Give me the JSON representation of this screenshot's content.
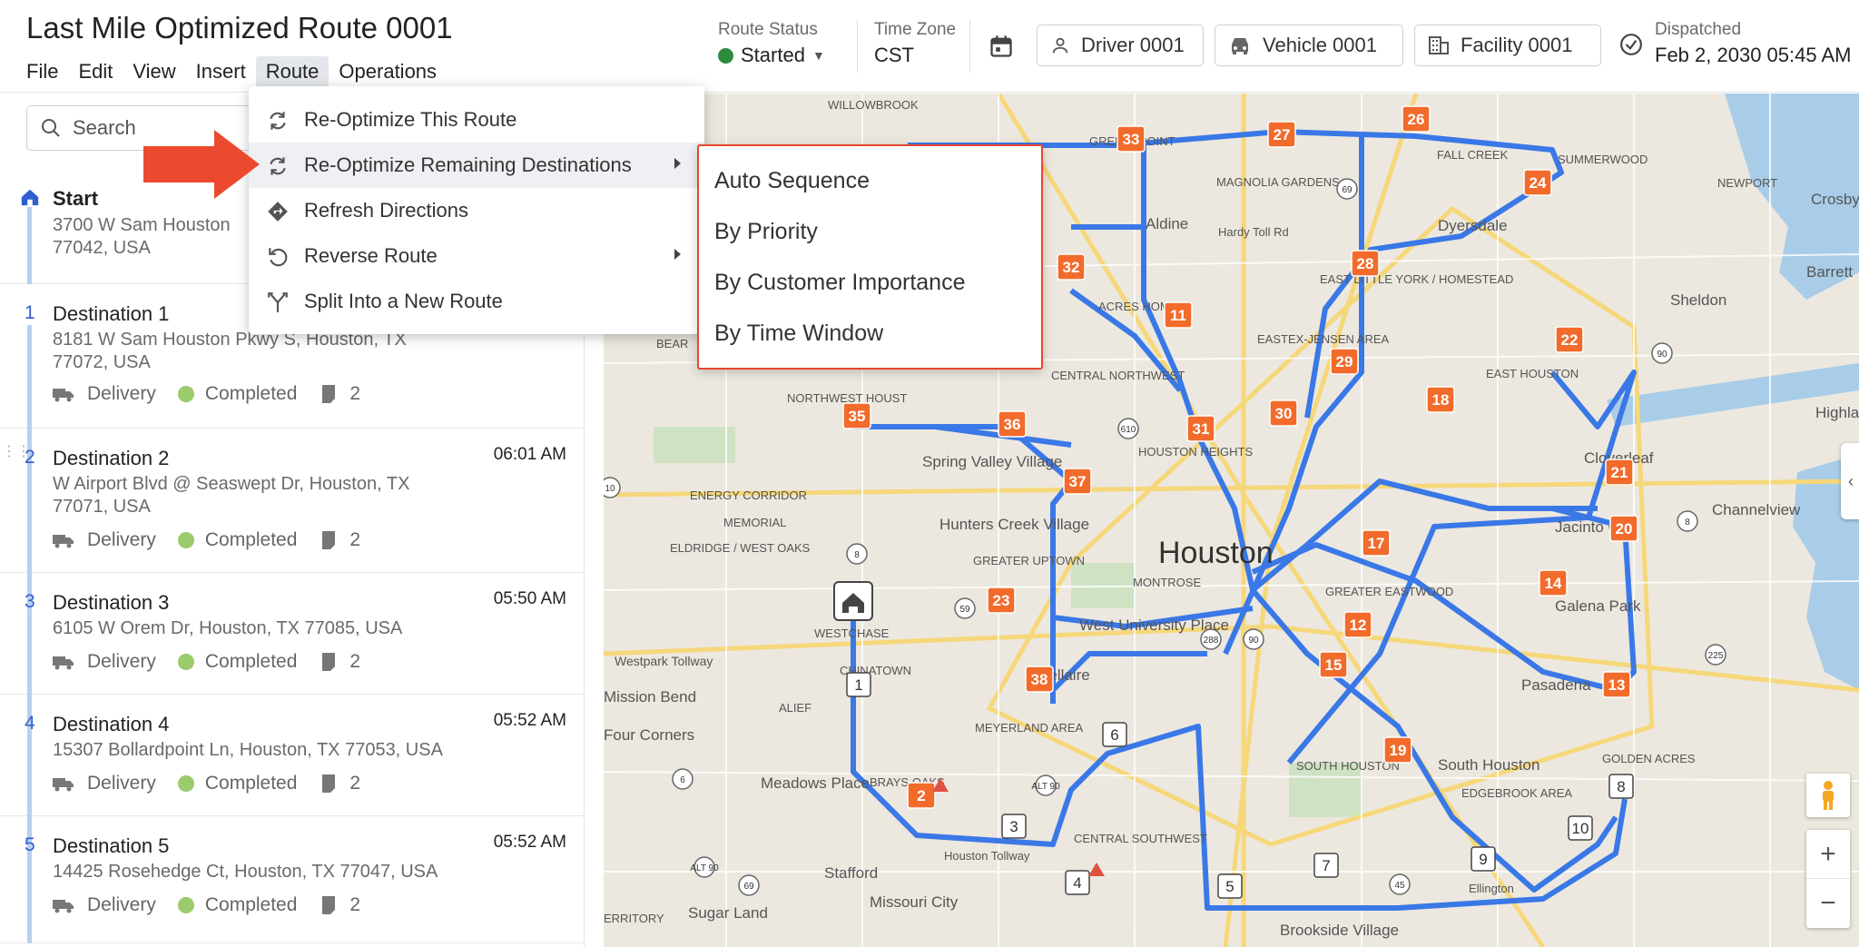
{
  "app": {
    "title": "Last Mile Optimized Route 0001",
    "menu": [
      "File",
      "Edit",
      "View",
      "Insert",
      "Route",
      "Operations"
    ],
    "active_menu": "Route"
  },
  "header": {
    "route_status_label": "Route Status",
    "route_status_value": "Started",
    "timezone_label": "Time Zone",
    "timezone_value": "CST",
    "driver": "Driver 0001",
    "vehicle": "Vehicle 0001",
    "facility": "Facility 0001",
    "dispatched_label": "Dispatched",
    "dispatched_value": "Feb 2, 2030 05:45 AM",
    "status_color": "#2e8b3e"
  },
  "sidebar": {
    "search_placeholder": "Search",
    "start": {
      "name": "Start",
      "address": "3700 W Sam Houston\n77042, USA"
    },
    "destinations": [
      {
        "num": "1",
        "name": "Destination 1",
        "address": "8181 W Sam Houston Pkwy S, Houston, TX\n77072, USA",
        "time": "",
        "type": "Delivery",
        "status": "Completed",
        "notes": "2"
      },
      {
        "num": "2",
        "name": "Destination 2",
        "address": "W Airport Blvd @ Seaswept Dr, Houston, TX\n77071, USA",
        "time": "06:01 AM",
        "type": "Delivery",
        "status": "Completed",
        "notes": "2"
      },
      {
        "num": "3",
        "name": "Destination 3",
        "address": "6105 W Orem Dr, Houston, TX 77085, USA",
        "time": "05:50 AM",
        "type": "Delivery",
        "status": "Completed",
        "notes": "2"
      },
      {
        "num": "4",
        "name": "Destination 4",
        "address": "15307 Bollardpoint Ln, Houston, TX 77053, USA",
        "time": "05:52 AM",
        "type": "Delivery",
        "status": "Completed",
        "notes": "2"
      },
      {
        "num": "5",
        "name": "Destination 5",
        "address": "14425 Rosehedge Ct, Houston, TX 77047, USA",
        "time": "05:52 AM",
        "type": "Delivery",
        "status": "Completed",
        "notes": "2"
      }
    ]
  },
  "route_menu": {
    "items": [
      {
        "label": "Re-Optimize This Route",
        "icon": "refresh-icon",
        "submenu": false
      },
      {
        "label": "Re-Optimize Remaining Destinations",
        "icon": "refresh-icon",
        "submenu": true
      },
      {
        "label": "Refresh Directions",
        "icon": "directions-icon",
        "submenu": false
      },
      {
        "label": "Reverse Route",
        "icon": "undo-icon",
        "submenu": true
      },
      {
        "label": "Split Into a New Route",
        "icon": "split-icon",
        "submenu": false
      }
    ],
    "submenu_items": [
      "Auto Sequence",
      "By Priority",
      "By Customer Importance",
      "By Time Window"
    ]
  },
  "map": {
    "city_label": "Houston",
    "place_labels": [
      "WILLOWBROOK",
      "GREENSPOINT",
      "FALL CREEK",
      "SUMMERWOOD",
      "NEWPORT",
      "Crosby",
      "MAGNOLIA GARDENS",
      "Dyersdale",
      "Barrett",
      "Aldine",
      "EAST LITTLE YORK / HOMESTEAD",
      "Sheldon",
      "ACRES HOME",
      "Hardy Toll Rd",
      "EASTEX-JENSEN AREA",
      "BEAR",
      "CENTRAL NORTHWEST",
      "EAST HOUSTON",
      "Highlar",
      "NORTHWEST HOUST",
      "Spring Valley Village",
      "HOUSTON HEIGHTS",
      "Cloverleaf",
      "ENERGY CORRIDOR",
      "MEMORIAL",
      "Hunters Creek Village",
      "Jacinto City",
      "Channelview",
      "ELDRIDGE / WEST OAKS",
      "GREATER UPTOWN",
      "MONTROSE",
      "GREATER EASTWOOD",
      "Galena Park",
      "WESTCHASE",
      "West University Place",
      "Westpark Tollway",
      "Bellaire",
      "CHINATOWN",
      "Pasadena",
      "Mission Bend",
      "ALIEF",
      "MEYERLAND AREA",
      "Four Corners",
      "GOLDEN ACRES",
      "SOUTH HOUSTON",
      "South Houston",
      "Meadows Place",
      "BRAYS OAKS",
      "EDGEBROOK AREA",
      "CENTRAL SOUTHWEST",
      "Stafford",
      "Missouri City",
      "Sugar Land",
      "ERRITORY",
      "Brookside Village",
      "Ellington",
      "Houston Tollway"
    ],
    "route_color": "#3a78e7",
    "marker_color": "#f26b2b",
    "orange_markers": [
      "27",
      "26",
      "33",
      "24",
      "28",
      "32",
      "11",
      "29",
      "22",
      "35",
      "36",
      "30",
      "31",
      "18",
      "37",
      "21",
      "20",
      "17",
      "14",
      "23",
      "12",
      "15",
      "38",
      "13",
      "19",
      "2"
    ],
    "white_markers": [
      "1",
      "3",
      "4",
      "5",
      "6",
      "7",
      "8",
      "9",
      "10"
    ],
    "highway_shields": [
      "69",
      "610",
      "10",
      "8",
      "90",
      "288",
      "59",
      "225",
      "90",
      "6",
      "ALT 90",
      "ALT 90",
      "69",
      "45",
      "8"
    ],
    "zoom_in": "+",
    "zoom_out": "−"
  }
}
